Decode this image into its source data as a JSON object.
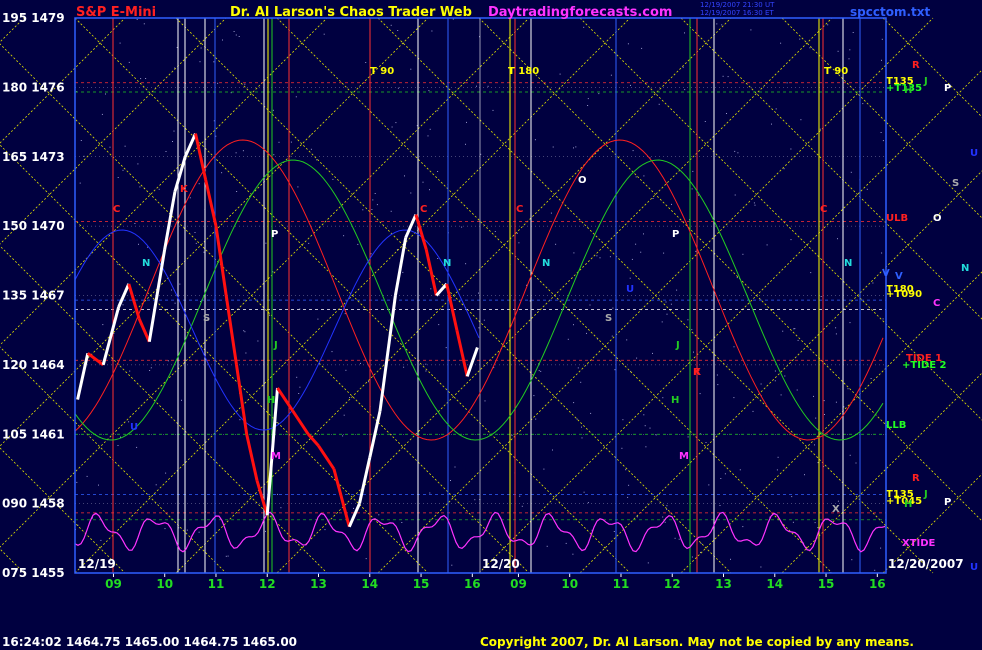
{
  "colors": {
    "background": "#000040",
    "plot_border": "#2f5fff",
    "yellow_grid": "#e0e000",
    "axis_text": "#ffffff",
    "hour_labels": "#22dd22",
    "title_red": "#ff2020",
    "title_yellow": "#ffff00",
    "title_magenta": "#ff33ff",
    "price_bar_up": "#ffffff",
    "price_bar_down": "#ff1010",
    "xtide": "#ff33ff",
    "field_red": "#ff2020",
    "field_green": "#22cc22"
  },
  "header": {
    "instrument": "S&P E-Mini",
    "title": "Dr. Al Larson's Chaos Trader Web",
    "site": "Daytradingforecasts.com",
    "timestamp_line1": "12/19/2007 21:30 UT",
    "timestamp_line2": "12/19/2007 16:30 ET",
    "file": "spcctom.txt"
  },
  "footer": {
    "quote": "16:24:02  1464.75 1465.00 1464.75 1465.00",
    "copyright": "Copyright 2007, Dr. Al Larson. May not be copied by any means."
  },
  "chart_data": {
    "type": "line",
    "title": "S&P E-Mini",
    "y_left_ticks": [
      {
        "angle": "195",
        "price": "1479"
      },
      {
        "angle": "180",
        "price": "1476"
      },
      {
        "angle": "165",
        "price": "1473"
      },
      {
        "angle": "150",
        "price": "1470"
      },
      {
        "angle": "135",
        "price": "1467"
      },
      {
        "angle": "120",
        "price": "1464"
      },
      {
        "angle": "105",
        "price": "1461"
      },
      {
        "angle": "090",
        "price": "1458"
      },
      {
        "angle": "075",
        "price": "1455"
      }
    ],
    "ylim": [
      1455,
      1479
    ],
    "x_date_labels": [
      "12/19",
      "12/20",
      "12/20/2007"
    ],
    "x_hour_labels": [
      "09",
      "10",
      "11",
      "12",
      "13",
      "14",
      "15",
      "16",
      "09",
      "10",
      "11",
      "12",
      "13",
      "14",
      "15",
      "16"
    ],
    "price_series": {
      "name": "S&P E-Mini price",
      "hours": [
        8.3,
        8.5,
        8.8,
        9.1,
        9.3,
        9.5,
        9.7,
        10.0,
        10.2,
        10.4,
        10.6,
        10.8,
        11.0,
        11.2,
        11.4,
        11.6,
        11.8,
        12.0,
        12.2,
        12.5,
        12.8,
        13.0,
        13.3,
        13.6,
        13.8,
        14.0,
        14.2,
        14.5,
        14.7,
        14.9,
        15.1,
        15.3,
        15.5,
        15.7,
        15.9,
        16.1
      ],
      "values": [
        1462.5,
        1464.5,
        1464.0,
        1466.5,
        1467.5,
        1466.0,
        1465.0,
        1469.0,
        1471.5,
        1473.0,
        1474.0,
        1472.0,
        1470.0,
        1467.0,
        1464.0,
        1461.0,
        1459.0,
        1457.5,
        1463.0,
        1462.0,
        1461.0,
        1460.5,
        1459.5,
        1457.0,
        1458.0,
        1460.0,
        1462.0,
        1467.0,
        1469.5,
        1470.5,
        1469.0,
        1467.0,
        1467.5,
        1465.5,
        1463.5,
        1464.75
      ]
    },
    "lines_labels": {
      "timing": [
        "T 90",
        "T 180",
        "T 90"
      ],
      "plot_markers": [
        "C",
        "C",
        "C",
        "C",
        "N",
        "N",
        "N",
        "N",
        "P",
        "P",
        "S",
        "S",
        "J",
        "J",
        "H",
        "H",
        "M",
        "M",
        "O",
        "K",
        "K",
        "U",
        "U",
        "R",
        "V",
        "X"
      ],
      "right_levels": [
        "R",
        "T135",
        "+T135",
        "J",
        "H",
        "P",
        "U",
        "S",
        "ULB",
        "O",
        "N",
        "V",
        "T180",
        "+T090",
        "C",
        "TIDE 1",
        "+TIDE 2",
        "LLB",
        "R",
        "T135",
        "+T045",
        "J",
        "H",
        "P",
        "XTIDE",
        "U"
      ]
    },
    "legend": "none",
    "grid": true
  }
}
